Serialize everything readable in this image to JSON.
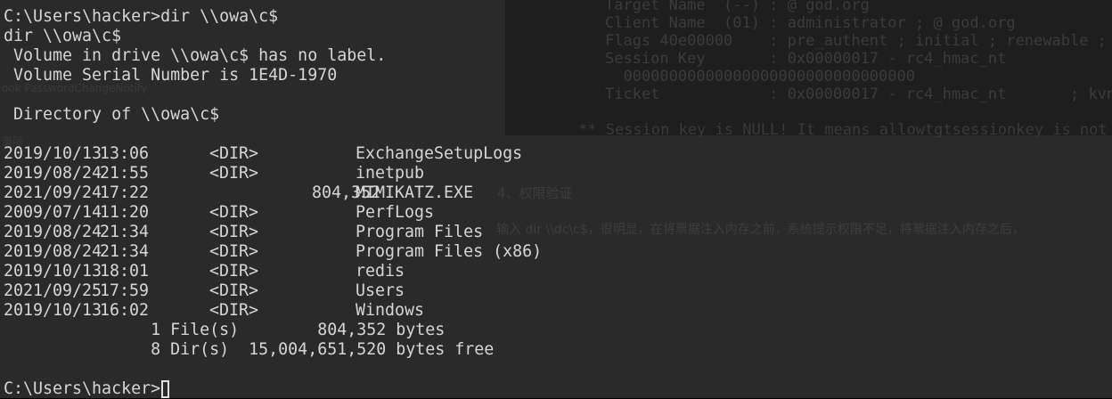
{
  "background": {
    "code_lines": [
      "Target Name  (--) : @ god.org",
      "Client Name  (01) : administrator ; @ god.org",
      "Flags 40e00000    : pre_authent ; initial ; renewable ;",
      "Session Key       : 0x00000017 - rc4_hmac_nt",
      "  00000000000000000000000000000000",
      "Ticket            : 0x00000017 - rc4_hmac_nt       ; kvno"
    ],
    "note_line": "** Session key is NULL! It means allowtgtsessionkey is not",
    "heading": "4、权限验证",
    "paragraph": "输入 dir \\\\dc\\c$，很明显，在将票据注入内存之前，系统提示权限不足，将票据注入内存之后，",
    "left_snippets": [
      "...",
      "ook PasswordChangeNotify",
      "清除"
    ]
  },
  "terminal": {
    "prompt_command": "C:\\Users\\hacker>dir \\\\owa\\c$",
    "echo": "dir \\\\owa\\c$",
    "volume_label": " Volume in drive \\\\owa\\c$ has no label.",
    "volume_serial": " Volume Serial Number is 1E4D-1970",
    "directory_of": " Directory of \\\\owa\\c$",
    "entries": [
      {
        "date": "2019/10/13",
        "time": "13:06",
        "type": "<DIR>",
        "size": "",
        "name": "ExchangeSetupLogs"
      },
      {
        "date": "2019/08/24",
        "time": "21:55",
        "type": "<DIR>",
        "size": "",
        "name": "inetpub"
      },
      {
        "date": "2021/09/24",
        "time": "17:22",
        "type": "",
        "size": "804,352",
        "name": "MIMIKATZ.EXE"
      },
      {
        "date": "2009/07/14",
        "time": "11:20",
        "type": "<DIR>",
        "size": "",
        "name": "PerfLogs"
      },
      {
        "date": "2019/08/24",
        "time": "21:34",
        "type": "<DIR>",
        "size": "",
        "name": "Program Files"
      },
      {
        "date": "2019/08/24",
        "time": "21:34",
        "type": "<DIR>",
        "size": "",
        "name": "Program Files (x86)"
      },
      {
        "date": "2019/10/13",
        "time": "18:01",
        "type": "<DIR>",
        "size": "",
        "name": "redis"
      },
      {
        "date": "2021/09/25",
        "time": "17:59",
        "type": "<DIR>",
        "size": "",
        "name": "Users"
      },
      {
        "date": "2019/10/13",
        "time": "16:02",
        "type": "<DIR>",
        "size": "",
        "name": "Windows"
      }
    ],
    "files_summary": "               1 File(s)        804,352 bytes",
    "dirs_summary": "               8 Dir(s)  15,004,651,520 bytes free",
    "final_prompt": "C:\\Users\\hacker>"
  }
}
